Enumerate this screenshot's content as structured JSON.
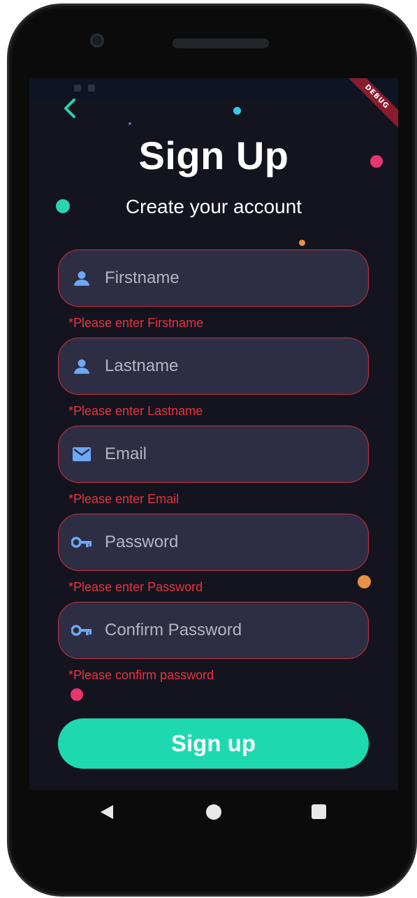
{
  "app": {
    "title": "Sign Up",
    "subtitle": "Create your account",
    "debug_banner": "DEBUG"
  },
  "colors": {
    "background": "#14141f",
    "field_bg": "#2d2e44",
    "error": "#e8343f",
    "accent": "#1ed9b0",
    "icon": "#6ea8f5"
  },
  "fields": [
    {
      "placeholder": "Firstname",
      "value": "",
      "icon": "person-icon",
      "error": "*Please enter Firstname"
    },
    {
      "placeholder": "Lastname",
      "value": "",
      "icon": "person-icon",
      "error": "*Please enter Lastname"
    },
    {
      "placeholder": "Email",
      "value": "",
      "icon": "mail-icon",
      "error": "*Please enter Email"
    },
    {
      "placeholder": "Password",
      "value": "",
      "icon": "key-icon",
      "error": "*Please enter Password"
    },
    {
      "placeholder": "Confirm Password",
      "value": "",
      "icon": "key-icon",
      "error": "*Please confirm password"
    }
  ],
  "buttons": {
    "signup_label": "Sign up"
  },
  "nav": {
    "back_icon": "triangle-back-icon",
    "home_icon": "circle-home-icon",
    "recent_icon": "square-recent-icon"
  }
}
